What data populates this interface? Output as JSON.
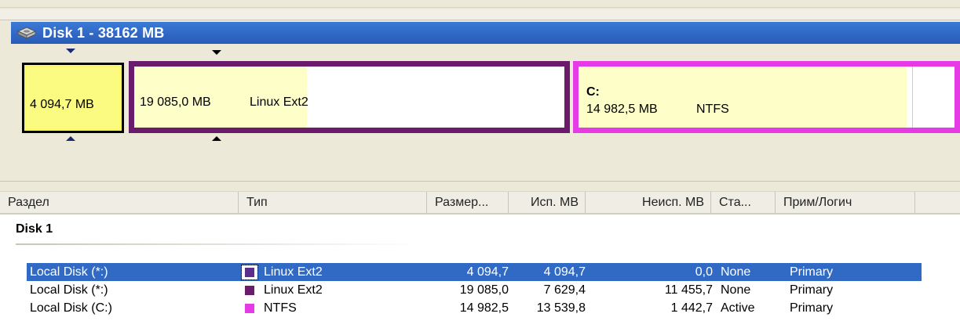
{
  "disk": {
    "title": "Disk 1 - 38162 MB",
    "icon": "hard-disk-icon"
  },
  "map": {
    "partitions": [
      {
        "size": "4 094,7 MB",
        "fs": "",
        "drive": "",
        "color": "#fbf96a",
        "selected": true
      },
      {
        "size": "19 085,0 MB",
        "fs": "Linux Ext2",
        "drive": "",
        "color": "#6b1b6b"
      },
      {
        "size": "14 982,5 MB",
        "fs": "NTFS",
        "drive": "C:",
        "color": "#e53ae5"
      }
    ]
  },
  "table": {
    "headers": [
      "Раздел",
      "Тип",
      "Размер...",
      "Исп. МВ",
      "Неисп. МВ",
      "Ста...",
      "Прим/Логич"
    ],
    "group": "Disk 1",
    "rows": [
      {
        "name": "Local Disk (*:)",
        "type": "Linux Ext2",
        "size": "4 094,7",
        "used": "4 094,7",
        "free": "0,0",
        "status": "None",
        "kind": "Primary",
        "color": "#5a2e8a",
        "selected": true
      },
      {
        "name": "Local Disk (*:)",
        "type": "Linux Ext2",
        "size": "19 085,0",
        "used": "7 629,4",
        "free": "11 455,7",
        "status": "None",
        "kind": "Primary",
        "color": "#6b1b6b",
        "selected": false
      },
      {
        "name": "Local Disk (C:)",
        "type": "NTFS",
        "size": "14 982,5",
        "used": "13 539,8",
        "free": "1 442,7",
        "status": "Active",
        "kind": "Primary",
        "color": "#e53ae5",
        "selected": false
      }
    ]
  },
  "colors": {
    "title_bar": "#2f66c4",
    "selection": "#316ac5"
  }
}
